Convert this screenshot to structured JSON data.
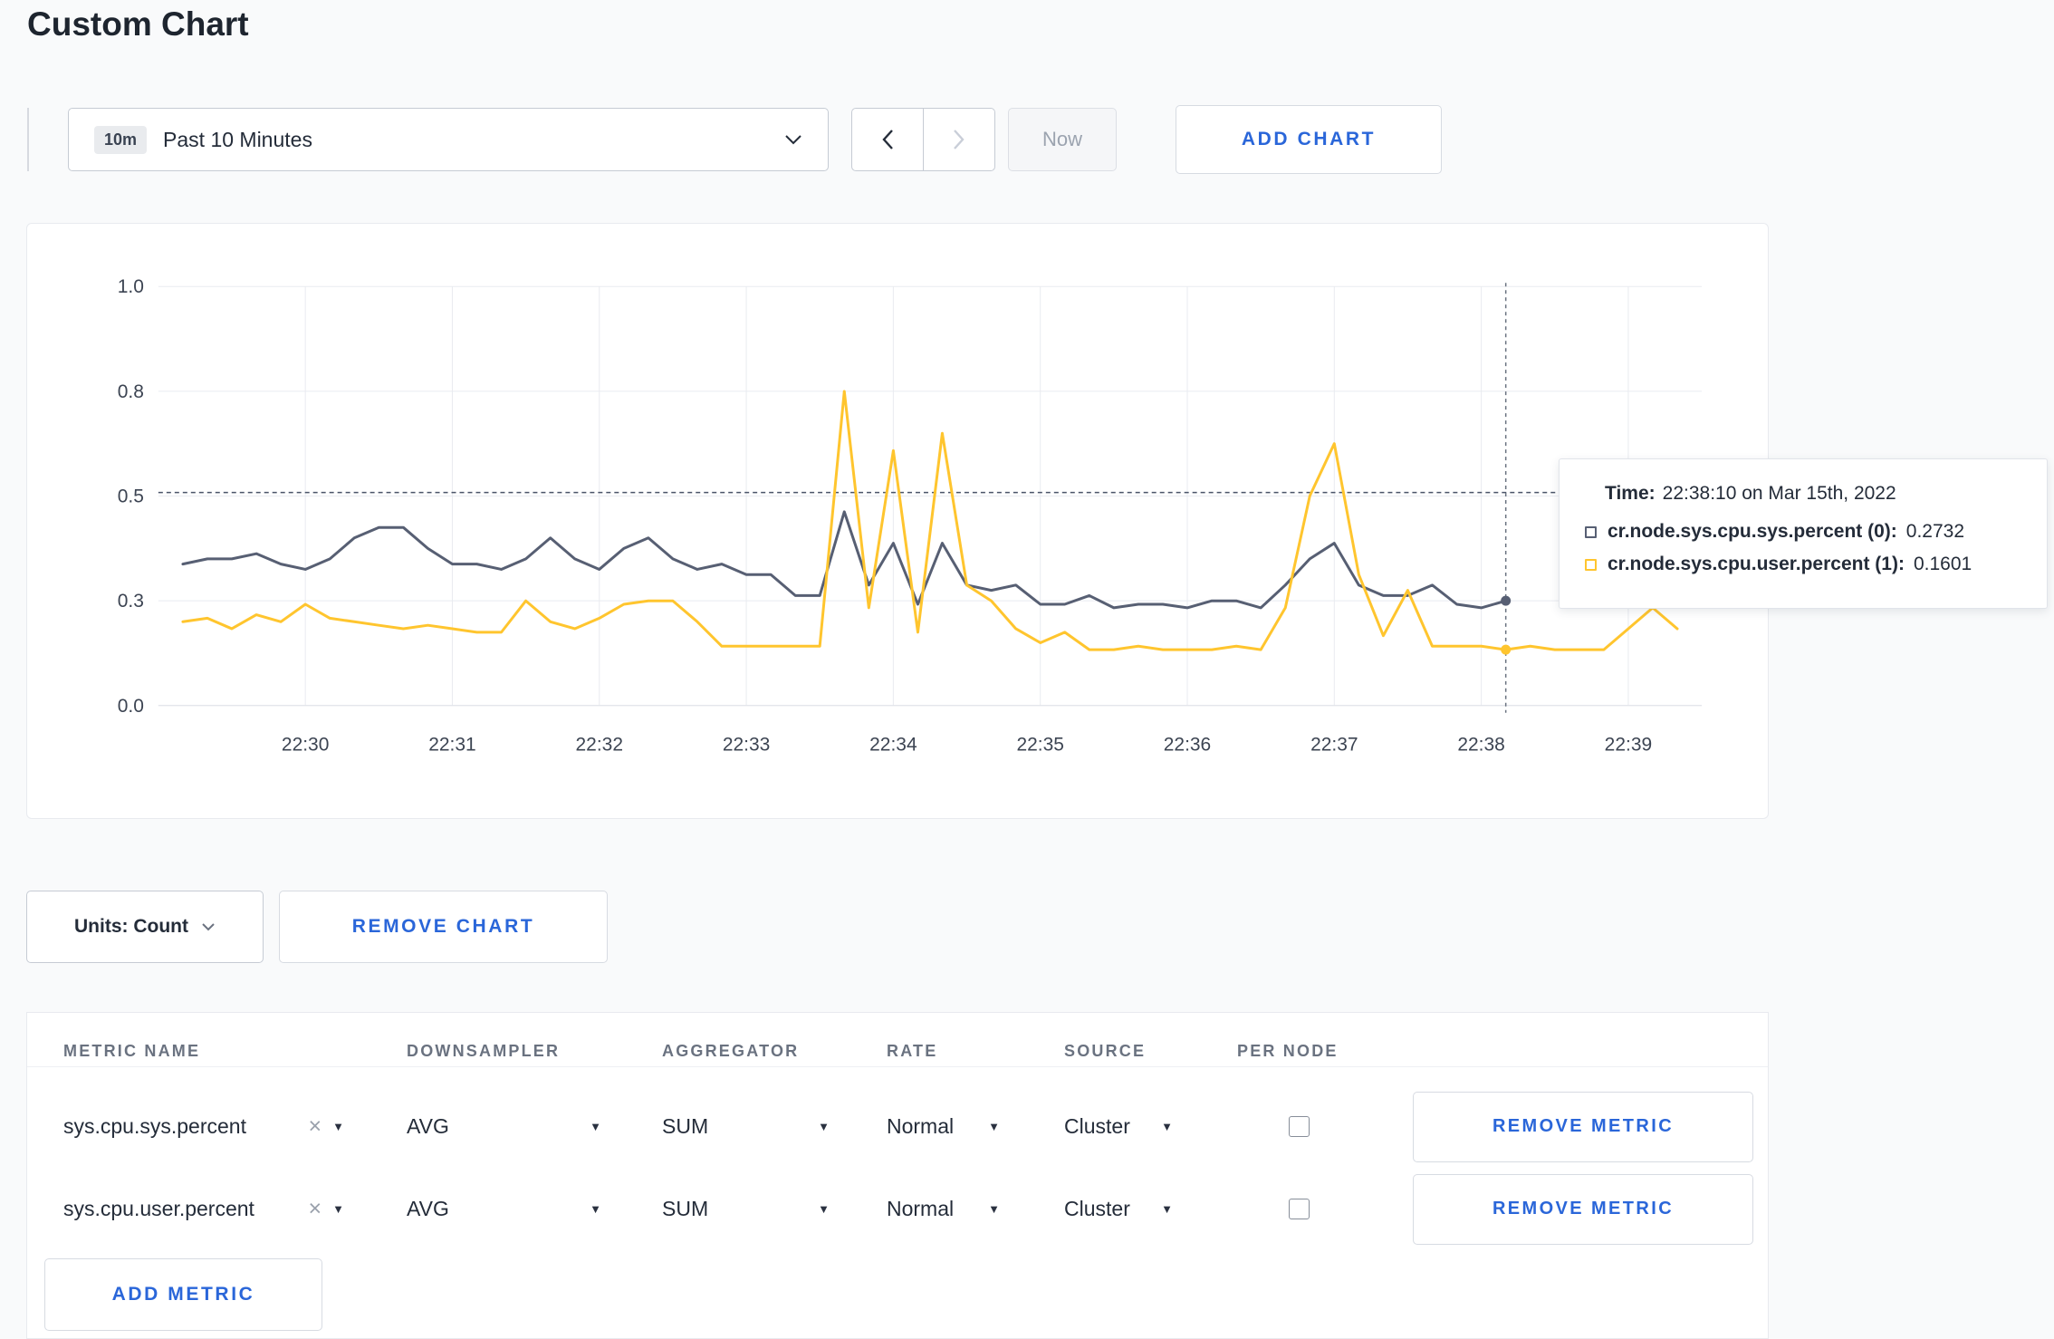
{
  "page": {
    "title": "Custom Chart",
    "background": "#f9fafb",
    "accent_blue": "#2a66d9"
  },
  "icons": {
    "caret_down": "▼",
    "close": "×"
  },
  "toolbar": {
    "time_range": {
      "badge": "10m",
      "label": "Past 10 Minutes"
    },
    "now_label": "Now",
    "add_chart_label": "ADD CHART"
  },
  "chart_controls": {
    "units_label": "Units: Count",
    "remove_chart_label": "REMOVE CHART",
    "add_metric_label": "ADD METRIC"
  },
  "tooltip": {
    "time_label": "Time:",
    "time_value": "22:38:10 on Mar 15th, 2022",
    "rows": [
      {
        "label": "cr.node.sys.cpu.sys.percent (0):",
        "value": "0.2732"
      },
      {
        "label": "cr.node.sys.cpu.user.percent (1):",
        "value": "0.1601"
      }
    ]
  },
  "chart_data": {
    "type": "line",
    "title": "",
    "xlabel": "",
    "ylabel": "",
    "ylim": [
      0,
      1.0
    ],
    "grid": true,
    "legend_position": "tooltip",
    "y_ticks": [
      0,
      0.3,
      0.5,
      0.8,
      1.0
    ],
    "y_tick_labels": [
      "0.0",
      "0.3",
      "0.5",
      "0.8",
      "1.0"
    ],
    "x_start_time": "22:29:00",
    "x_domain": [
      0,
      630
    ],
    "x_ticks_sec": [
      60,
      120,
      180,
      240,
      300,
      360,
      420,
      480,
      540,
      600
    ],
    "x_tick_labels": [
      "22:30",
      "22:31",
      "22:32",
      "22:33",
      "22:34",
      "22:35",
      "22:36",
      "22:37",
      "22:38",
      "22:39"
    ],
    "crosshair": {
      "time": "22:38:10",
      "x_sec": 550,
      "hline_value": 0.51
    },
    "series": [
      {
        "name": "cr.node.sys.cpu.sys.percent",
        "color": "#575f73",
        "start_sec": 10,
        "step_sec": 10,
        "values": [
          0.37,
          0.38,
          0.38,
          0.39,
          0.37,
          0.36,
          0.38,
          0.42,
          0.44,
          0.44,
          0.4,
          0.37,
          0.37,
          0.36,
          0.38,
          0.42,
          0.38,
          0.36,
          0.4,
          0.42,
          0.38,
          0.36,
          0.37,
          0.35,
          0.35,
          0.31,
          0.31,
          0.47,
          0.33,
          0.41,
          0.29,
          0.41,
          0.33,
          0.32,
          0.33,
          0.29,
          0.29,
          0.31,
          0.28,
          0.29,
          0.29,
          0.28,
          0.3,
          0.3,
          0.28,
          0.33,
          0.38,
          0.41,
          0.33,
          0.31,
          0.31,
          0.33,
          0.29,
          0.28,
          0.3
        ]
      },
      {
        "name": "cr.node.sys.cpu.user.percent",
        "color": "#ffc52e",
        "start_sec": 10,
        "step_sec": 10,
        "values": [
          0.24,
          0.25,
          0.22,
          0.26,
          0.24,
          0.29,
          0.25,
          0.24,
          0.23,
          0.22,
          0.23,
          0.22,
          0.21,
          0.21,
          0.3,
          0.24,
          0.22,
          0.25,
          0.29,
          0.3,
          0.3,
          0.24,
          0.17,
          0.17,
          0.17,
          0.17,
          0.17,
          0.8,
          0.28,
          0.63,
          0.21,
          0.68,
          0.33,
          0.3,
          0.22,
          0.18,
          0.21,
          0.16,
          0.16,
          0.17,
          0.16,
          0.16,
          0.16,
          0.17,
          0.16,
          0.28,
          0.5,
          0.65,
          0.35,
          0.2,
          0.32,
          0.17,
          0.17,
          0.17,
          0.16,
          0.17,
          0.16,
          0.16,
          0.16,
          0.22,
          0.28,
          0.22
        ]
      }
    ]
  },
  "metrics_table": {
    "headers": [
      "METRIC NAME",
      "DOWNSAMPLER",
      "AGGREGATOR",
      "RATE",
      "SOURCE",
      "PER NODE"
    ],
    "rows": [
      {
        "metric": "sys.cpu.sys.percent",
        "downsampler": "AVG",
        "aggregator": "SUM",
        "rate": "Normal",
        "source": "Cluster",
        "per_node": false,
        "remove_label": "REMOVE METRIC"
      },
      {
        "metric": "sys.cpu.user.percent",
        "downsampler": "AVG",
        "aggregator": "SUM",
        "rate": "Normal",
        "source": "Cluster",
        "per_node": false,
        "remove_label": "REMOVE METRIC"
      }
    ]
  }
}
